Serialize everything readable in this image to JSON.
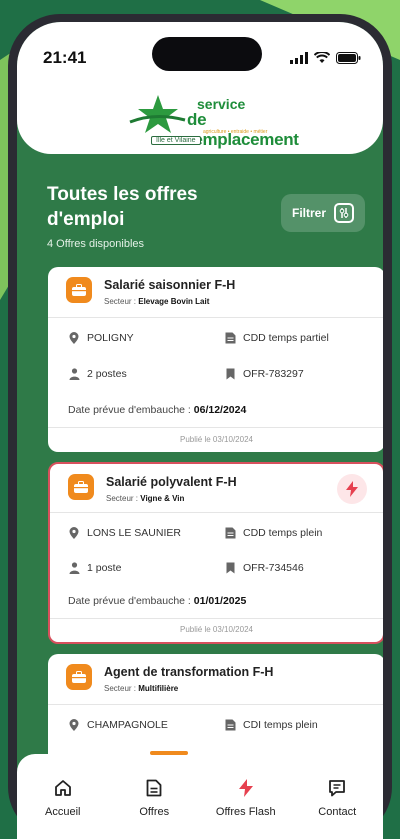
{
  "status": {
    "time": "21:41"
  },
  "logo": {
    "line1": "service",
    "line2": "de remplacement",
    "tagline": "agriculture • entraide • métier",
    "region": "Ille et Vilaine"
  },
  "header": {
    "title": "Toutes les offres d'emploi",
    "count": "4 Offres disponibles",
    "filter_label": "Filtrer"
  },
  "cards": [
    {
      "title": "Salarié saisonnier F-H",
      "sector_label": "Secteur :",
      "sector": "Elevage Bovin Lait",
      "location": "POLIGNY",
      "contract": "CDD temps partiel",
      "positions": "2 postes",
      "reference": "OFR-783297",
      "hire_label": "Date prévue d'embauche :",
      "hire_date": "06/12/2024",
      "published": "Publié le 03/10/2024",
      "flash": false
    },
    {
      "title": "Salarié polyvalent F-H",
      "sector_label": "Secteur :",
      "sector": "Vigne & Vin",
      "location": "LONS LE SAUNIER",
      "contract": "CDD temps plein",
      "positions": "1 poste",
      "reference": "OFR-734546",
      "hire_label": "Date prévue d'embauche :",
      "hire_date": "01/01/2025",
      "published": "Publié le 03/10/2024",
      "flash": true
    },
    {
      "title": "Agent de transformation F-H",
      "sector_label": "Secteur :",
      "sector": "Multifilière",
      "location": "CHAMPAGNOLE",
      "contract": "CDI temps plein",
      "flash": false
    }
  ],
  "nav": {
    "home": "Accueil",
    "offers": "Offres",
    "flash": "Offres Flash",
    "contact": "Contact"
  },
  "colors": {
    "brand_green": "#2f7a48",
    "accent_orange": "#f08a1d",
    "flash_red": "#d7505d"
  },
  "icons": [
    "signal-icon",
    "wifi-icon",
    "battery-icon",
    "filter-icon",
    "briefcase-icon",
    "location-pin-icon",
    "document-icon",
    "person-icon",
    "bookmark-icon",
    "lightning-icon",
    "home-icon",
    "offers-icon",
    "chat-icon"
  ]
}
